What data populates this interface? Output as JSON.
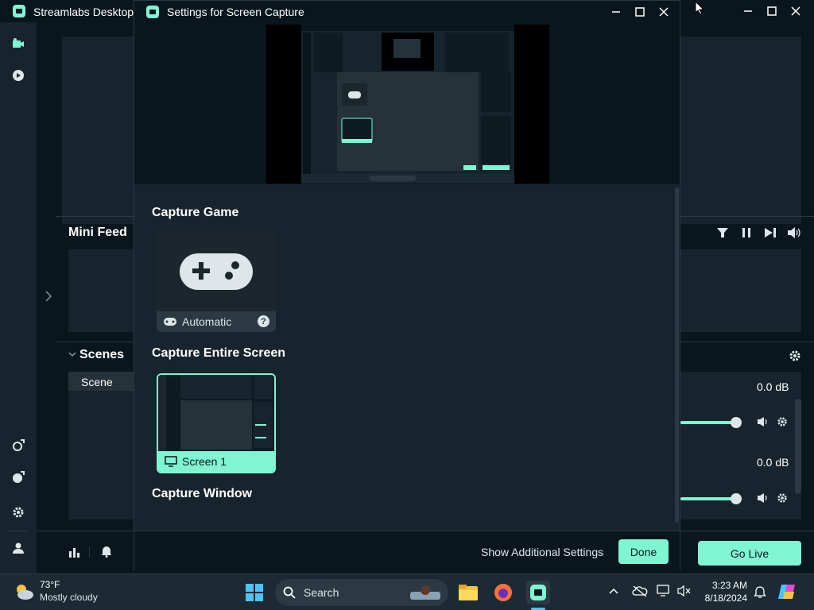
{
  "app": {
    "title": "Streamlabs Desktop",
    "mini_feed_title": "Mini Feed",
    "scenes_title": "Scenes",
    "scene_item": "Scene",
    "go_live": "Go Live",
    "mixer": {
      "channel1_db": "0.0 dB",
      "channel2_db": "0.0 dB",
      "channel1_level": 1.0,
      "channel2_level": 1.0
    }
  },
  "dialog": {
    "title": "Settings for Screen Capture",
    "capture_game_title": "Capture Game",
    "automatic_label": "Automatic",
    "capture_entire_screen_title": "Capture Entire Screen",
    "screen_label": "Screen 1",
    "capture_window_title": "Capture Window",
    "show_additional_settings": "Show Additional Settings",
    "done": "Done"
  },
  "taskbar": {
    "weather_temp": "73°F",
    "weather_desc": "Mostly cloudy",
    "search_placeholder": "Search",
    "time": "3:23 AM",
    "date": "8/18/2024"
  },
  "colors": {
    "accent": "#80f5d2",
    "background": "#09161d",
    "panel": "#17242d"
  }
}
